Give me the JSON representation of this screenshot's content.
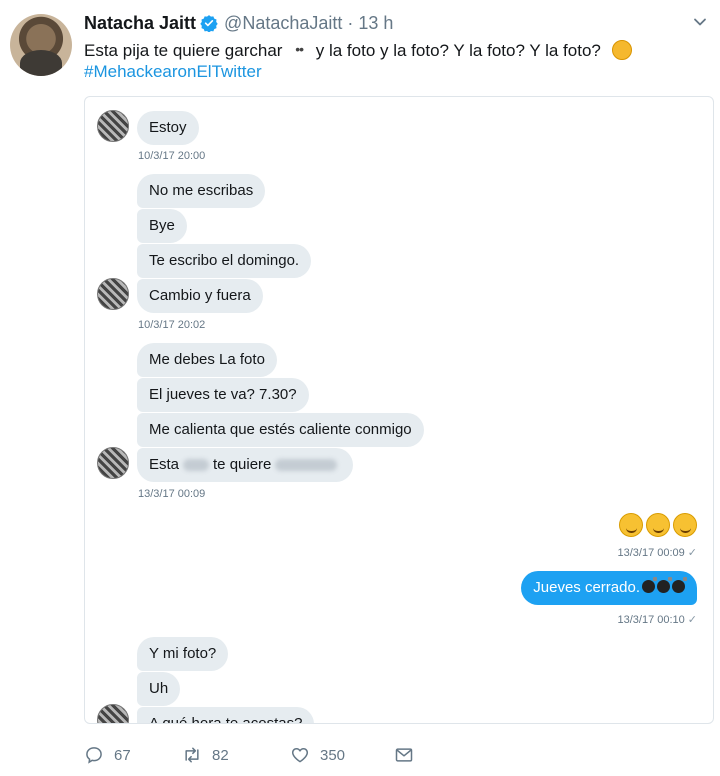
{
  "tweet": {
    "name": "Natacha Jaitt",
    "handle": "@NatachaJaitt",
    "separator": "·",
    "time": "13 h",
    "text_part1": "Esta pija te quiere garchar",
    "eyes": "••",
    "text_part2": "y la foto y la foto? Y la foto? Y la foto?",
    "hashtag": "#MehackearonElTwitter"
  },
  "conversation": {
    "messages": [
      {
        "text": "Estoy"
      },
      {
        "text": "No me escribas"
      },
      {
        "text": "Bye"
      },
      {
        "text": "Te escribo el domingo."
      },
      {
        "text": "Cambio y fuera"
      },
      {
        "text": "Me debes La foto"
      },
      {
        "text": "El jueves te va? 7.30?"
      },
      {
        "text": "Me calienta que estés caliente conmigo"
      },
      {
        "text_before": "Esta",
        "text_after": "te quiere"
      },
      {
        "text": "Jueves cerrado."
      },
      {
        "text": "Y mi foto?"
      },
      {
        "text": "Uh"
      },
      {
        "text": "A qué hora te acostas?"
      }
    ],
    "timestamps": [
      {
        "text": "10/3/17 20:00"
      },
      {
        "text": "10/3/17 20:02"
      },
      {
        "text": "13/3/17 00:09"
      },
      {
        "text": "13/3/17 00:09"
      },
      {
        "text": "13/3/17 00:10"
      }
    ],
    "read_check": "✓"
  },
  "actions": {
    "reply_count": "67",
    "retweet_count": "82",
    "like_count": "350"
  },
  "colors": {
    "link": "#1b95e0",
    "sent_bubble": "#1da1f2",
    "received_bubble": "#e6ecf0",
    "muted": "#657786"
  },
  "icons": {
    "verified": "verified-badge-icon",
    "caret": "chevron-down-icon",
    "reply": "reply-icon",
    "retweet": "retweet-icon",
    "like": "heart-icon",
    "dm": "envelope-icon"
  }
}
